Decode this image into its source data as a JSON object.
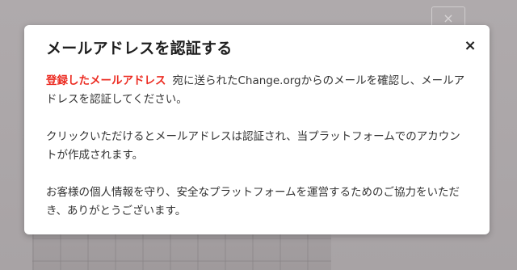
{
  "background": {
    "close_label": "×"
  },
  "modal": {
    "title": "メールアドレスを認証する",
    "close_label": "×",
    "email_highlight": "登録したメールアドレス",
    "paragraph1_rest": "宛に送られたChange.orgからのメールを確認し、メールアドレスを認証してください。",
    "paragraph2": "クリックいただけるとメールアドレスは認証され、当プラットフォームでのアカウントが作成されます。",
    "paragraph3": "お客様の個人情報を守り、安全なプラットフォームを運営するためのご協力をいただき、ありがとうございます。"
  },
  "colors": {
    "accent_red": "#ec2c22",
    "overlay": "#a8a3a5"
  }
}
